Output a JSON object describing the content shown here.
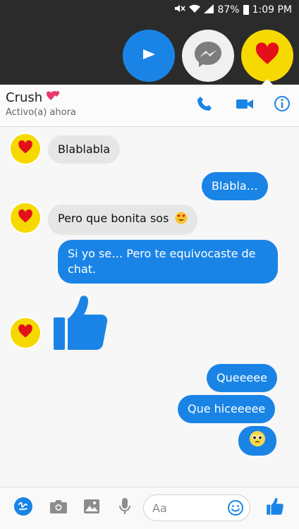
{
  "status_bar": {
    "battery": "87%",
    "time": "1:09 PM"
  },
  "chat_heads": [
    {
      "name": "video-head"
    },
    {
      "name": "messenger-head"
    },
    {
      "name": "crush-head"
    }
  ],
  "header": {
    "contact_name": "Crush",
    "contact_status": "Activo(a) ahora"
  },
  "messages": [
    {
      "side": "in",
      "text": "Blablabla"
    },
    {
      "side": "out",
      "text": "Blabla…"
    },
    {
      "side": "in",
      "text": "Pero que bonita sos"
    },
    {
      "side": "out",
      "text": "Si yo se… Pero te equivocaste de chat."
    },
    {
      "side": "in",
      "type": "like"
    },
    {
      "side": "out",
      "text": "Queeeee"
    },
    {
      "side": "out",
      "text": "Que hiceeeee"
    },
    {
      "side": "out",
      "type": "emoji"
    }
  ],
  "composer": {
    "placeholder": "Aa"
  },
  "colors": {
    "accent": "#1a84e6",
    "avatar_bg": "#f6d900",
    "heart": "#e3101a"
  }
}
